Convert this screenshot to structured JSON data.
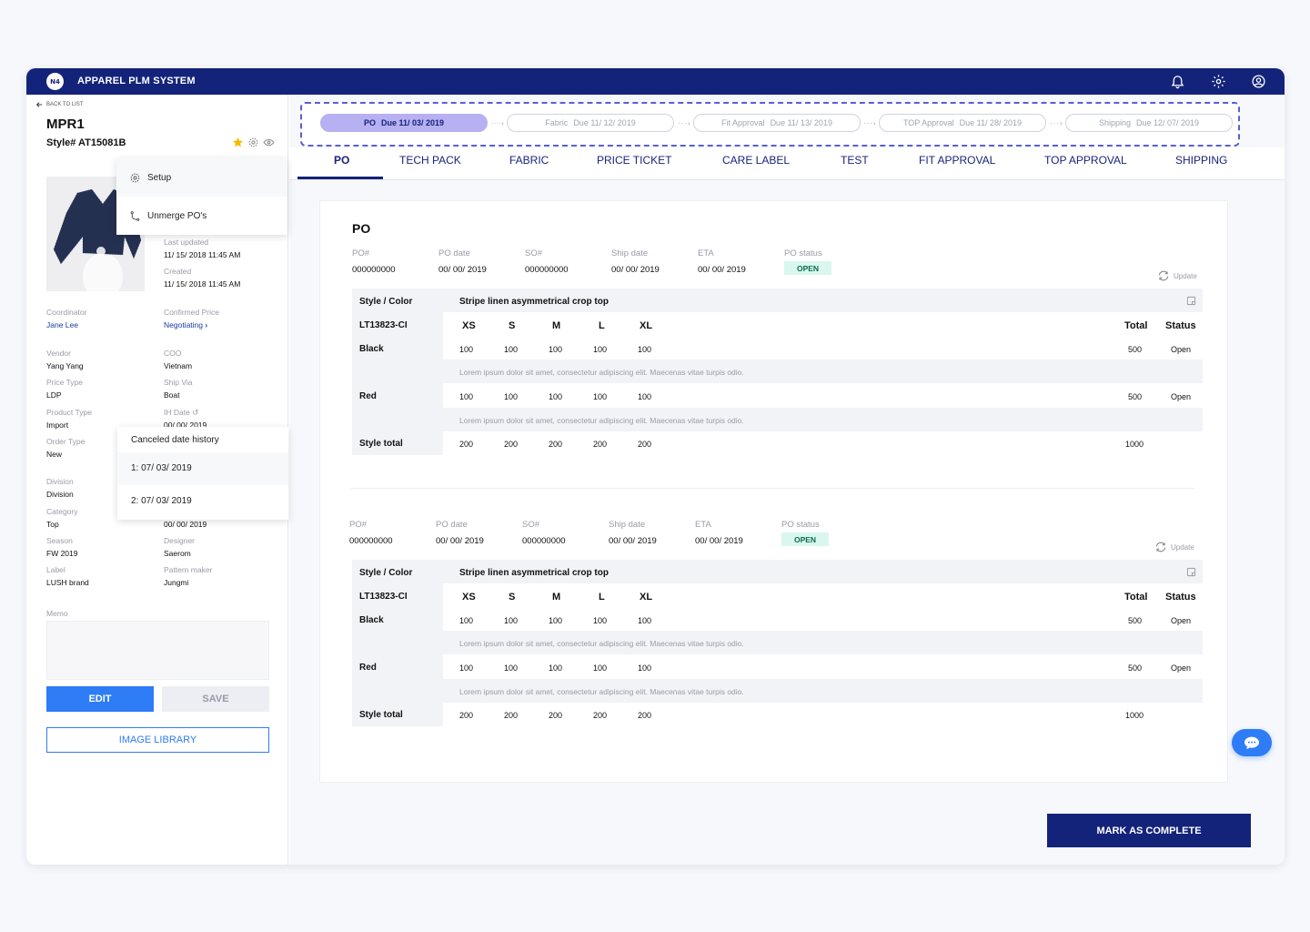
{
  "app": {
    "logo_text": "N4",
    "title": "APPAREL PLM SYSTEM"
  },
  "icons": {
    "notifications": "bell-icon",
    "settings": "gear-icon",
    "profile": "user-circle-icon"
  },
  "colors": {
    "navy": "#14237a",
    "accent": "#2e7cf6",
    "stage_active": "#b7b0f2",
    "open_badge": "#d9f7ef",
    "favorite": "#f5b800"
  },
  "left": {
    "back": "BACK TO LIST",
    "title": "MPR1",
    "style": "Style# AT15081B",
    "fields": [
      {
        "label": "Last updated",
        "value": "11/ 15/ 2018 11:45 AM"
      },
      {
        "label": "Created",
        "value": "11/ 15/ 2018 11:45 AM"
      },
      {
        "label": "Coordinator",
        "value": "Jane Lee"
      },
      {
        "label": "Confirmed Price",
        "value": "Negotiating"
      },
      {
        "label": "Vendor",
        "value": "Yang Yang"
      },
      {
        "label": "COO",
        "value": "Vietnam"
      },
      {
        "label": "Price Type",
        "value": "LDP"
      },
      {
        "label": "Ship Via",
        "value": "Boat"
      },
      {
        "label": "Product Type",
        "value": "Import"
      },
      {
        "label": "IH Date",
        "value": "00/ 00/ 2019"
      },
      {
        "label": "Order Type",
        "value": "New"
      },
      {
        "label": "Division",
        "value": "Division"
      },
      {
        "label": "Category",
        "value": "Top"
      },
      {
        "label": "",
        "value": "00/ 00/ 2019"
      },
      {
        "label": "Season",
        "value": "FW 2019"
      },
      {
        "label": "Designer",
        "value": "Saerom"
      },
      {
        "label": "Label",
        "value": "LUSH brand"
      },
      {
        "label": "Pattern maker",
        "value": "Jungmi"
      }
    ],
    "memo_label": "Memo",
    "edit": "EDIT",
    "save": "SAVE",
    "image_library": "IMAGE LIBRARY"
  },
  "setup_menu": {
    "items": [
      "Setup",
      "Unmerge PO's"
    ]
  },
  "canceled_history": {
    "title": "Canceled date history",
    "items": [
      "1: 07/ 03/ 2019",
      "2: 07/ 03/ 2019"
    ]
  },
  "stages": [
    {
      "name": "PO",
      "due": "Due 11/ 03/ 2019"
    },
    {
      "name": "Fabric",
      "due": "Due 11/ 12/ 2019"
    },
    {
      "name": "Fit Approval",
      "due": "Due 11/ 13/ 2019"
    },
    {
      "name": "TOP Approval",
      "due": "Due 11/ 28/ 2019"
    },
    {
      "name": "Shipping",
      "due": "Due 12/ 07/ 2019"
    }
  ],
  "tabs": [
    "PO",
    "TECH PACK",
    "FABRIC",
    "PRICE TICKET",
    "CARE LABEL",
    "TEST",
    "FIT APPROVAL",
    "TOP APPROVAL",
    "SHIPPING"
  ],
  "po_section": {
    "title": "PO",
    "headers": [
      "PO#",
      "PO date",
      "SO#",
      "Ship date",
      "ETA",
      "PO status"
    ],
    "values": [
      "000000000",
      "00/ 00/ 2019",
      "000000000",
      "00/ 00/ 2019",
      "00/ 00/ 2019",
      "OPEN"
    ],
    "update": "Update",
    "table": {
      "style_color_label": "Style / Color",
      "description": "Stripe linen asymmetrical crop top",
      "style_code": "LT13823-CI",
      "sizes": [
        "XS",
        "S",
        "M",
        "L",
        "XL"
      ],
      "total_label": "Total",
      "status_label": "Status",
      "rows": [
        {
          "color": "Black",
          "qty": [
            "100",
            "100",
            "100",
            "100",
            "100"
          ],
          "total": "500",
          "status": "Open",
          "note": "Lorem ipsum dolor sit amet, consectetur adipiscing elit. Maecenas vitae turpis odio."
        },
        {
          "color": "Red",
          "qty": [
            "100",
            "100",
            "100",
            "100",
            "100"
          ],
          "total": "500",
          "status": "Open",
          "note": "Lorem ipsum dolor sit amet, consectetur adipiscing elit. Maecenas vitae turpis odio."
        }
      ],
      "style_total_label": "Style total",
      "style_totals": [
        "200",
        "200",
        "200",
        "200",
        "200"
      ],
      "grand_total": "1000"
    }
  },
  "mark_complete": "MARK AS COMPLETE",
  "chat_icon": "chat-bubble-icon"
}
